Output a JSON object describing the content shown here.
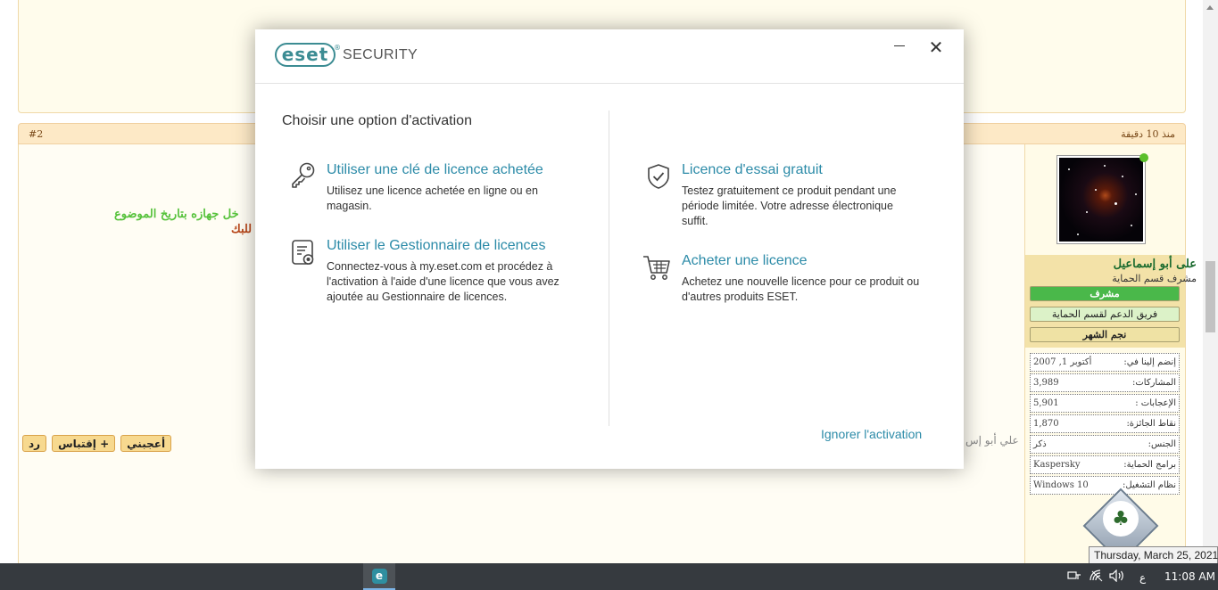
{
  "forum": {
    "post_number": "#2",
    "post_time": "منذ 10 دقيقة",
    "post_text_green": "خل جهازه بتاريخ الموضوع",
    "post_text_brown": "للبك",
    "signature": "علي أبو إس",
    "actions": {
      "like_label": "أعجبني",
      "quote_label": "+ إقتباس",
      "reply_label": "رد"
    },
    "user": {
      "name": "على أبو إسماعيل",
      "role": "مشرف قسم الحماية",
      "ranks": [
        "مشرف",
        "فريق الدعم لقسم الحماية",
        "نجم الشهر"
      ]
    },
    "stats": [
      {
        "label": "إنضم إلينا في:",
        "value": "أكتوبر 1, 2007"
      },
      {
        "label": "المشاركات:",
        "value": "3,989"
      },
      {
        "label": "الإعجابات :",
        "value": "5,901"
      },
      {
        "label": "نقاط الجائزة:",
        "value": "1,870"
      },
      {
        "label": "الجنس:",
        "value": "ذكر"
      },
      {
        "label": "برامج الحماية:",
        "value": "Kaspersky"
      },
      {
        "label": "نظام التشغيل:",
        "value": "Windows 10"
      }
    ]
  },
  "dialog": {
    "logo_text": "eset",
    "logo_reg": "®",
    "logo_product": "SECURITY",
    "title": "Choisir une option d'activation",
    "options": [
      {
        "title": "Utiliser une clé de licence achetée",
        "description": "Utilisez une licence achetée en ligne ou en magasin."
      },
      {
        "title": "Utiliser le Gestionnaire de licences",
        "description": "Connectez-vous à my.eset.com et procédez à l'activation à l'aide d'une licence que vous avez ajoutée au Gestionnaire de licences."
      },
      {
        "title": "Licence d'essai gratuit",
        "description": "Testez gratuitement ce produit pendant une période limitée. Votre adresse électronique suffit."
      },
      {
        "title": "Acheter une licence",
        "description": "Achetez une nouvelle licence pour ce produit ou d'autres produits ESET."
      }
    ],
    "ignore_label": "Ignorer l'activation",
    "close_glyph": "✕"
  },
  "taskbar": {
    "app_icon_letter": "e",
    "language": "ع",
    "time": "11:08 AM",
    "date_tooltip": "Thursday, March 25, 2021"
  },
  "colors": {
    "eset_teal": "#3c8c93",
    "link_blue": "#2c8ba8",
    "forum_header": "#fde9c6",
    "taskbar": "#363a3f"
  }
}
